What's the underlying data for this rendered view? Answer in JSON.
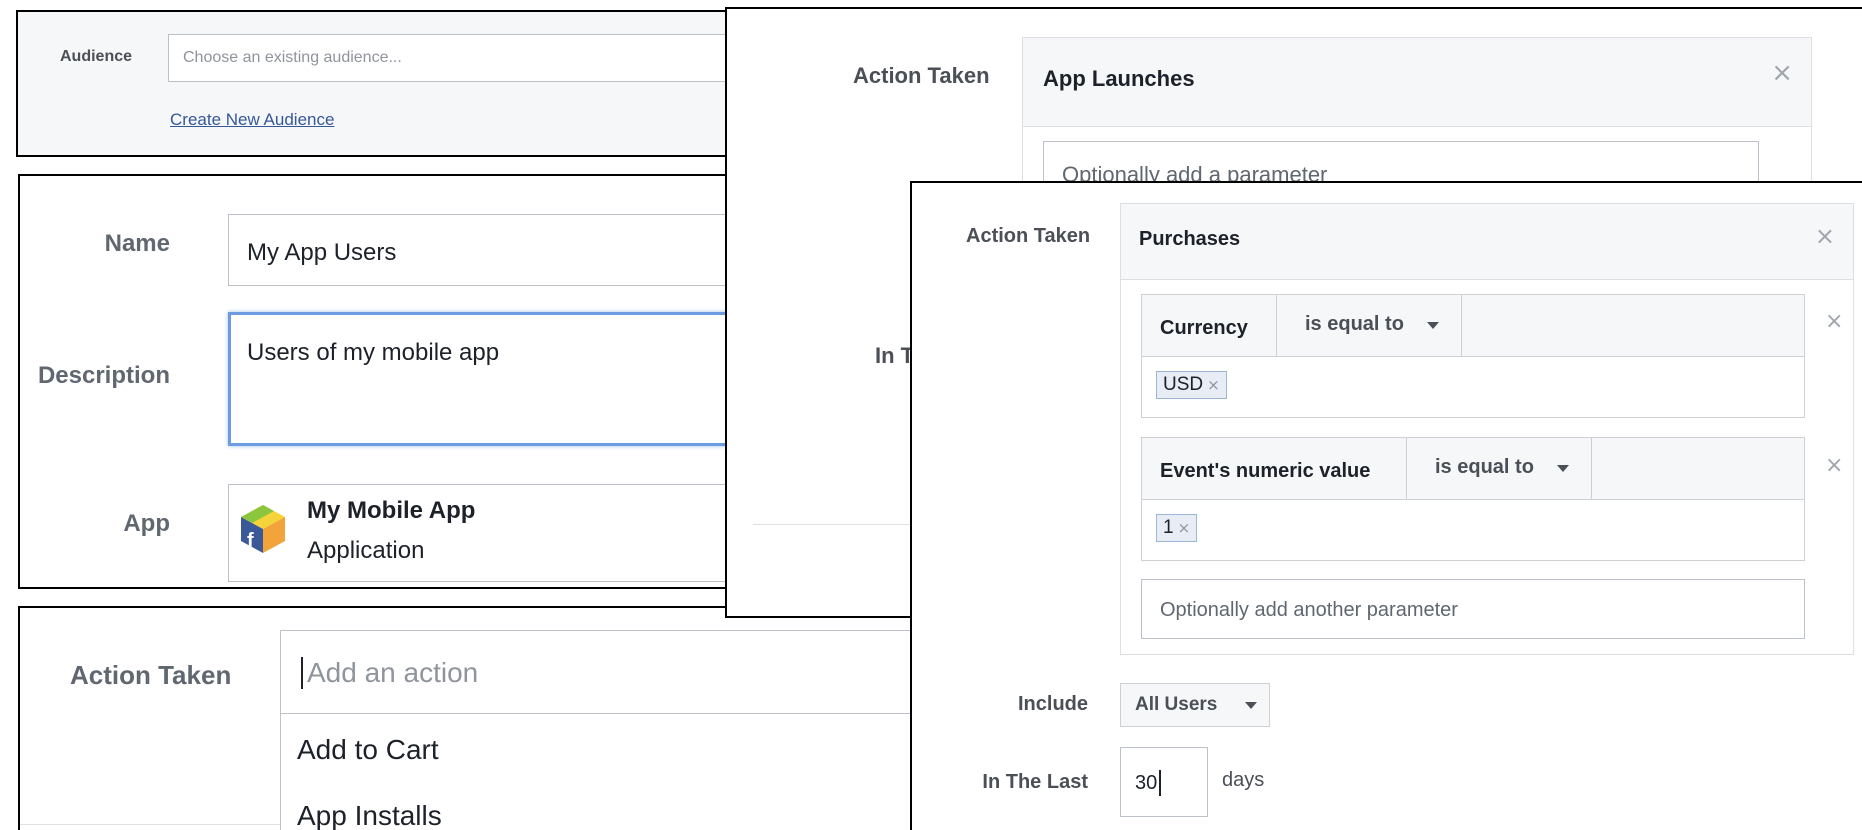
{
  "audience_panel": {
    "label": "Audience",
    "placeholder": "Choose an existing audience...",
    "create_link": "Create New Audience"
  },
  "details_panel": {
    "name_label": "Name",
    "name_value": "My App Users",
    "description_label": "Description",
    "description_value": "Users of my mobile app",
    "app_label": "App",
    "app_name": "My Mobile App",
    "app_type": "Application"
  },
  "action_dropdown_panel": {
    "label": "Action Taken",
    "placeholder": "Add an action",
    "options": [
      "Add to Cart",
      "App Installs"
    ]
  },
  "app_launches_panel": {
    "label": "Action Taken",
    "action": "App Launches",
    "param_placeholder": "Optionally add a parameter",
    "partial_label": "In T"
  },
  "purchases_panel": {
    "label": "Action Taken",
    "action": "Purchases",
    "params": [
      {
        "name": "Currency",
        "operator": "is equal to",
        "tokens": [
          "USD"
        ]
      },
      {
        "name": "Event's numeric value",
        "operator": "is equal to",
        "tokens": [
          "1"
        ]
      }
    ],
    "another_param_placeholder": "Optionally add another parameter",
    "include_label": "Include",
    "include_value": "All Users",
    "in_last_label": "In The Last",
    "in_last_value": "30",
    "days_label": "days"
  },
  "icons": {
    "remove": "close-icon",
    "dropdown": "caret-down-icon",
    "app": "facebook-app-cube-icon"
  },
  "colors": {
    "link": "#365899",
    "focus_border": "#6d9de0",
    "label_gray": "#4b4f56",
    "placeholder_gray": "#90949c"
  }
}
